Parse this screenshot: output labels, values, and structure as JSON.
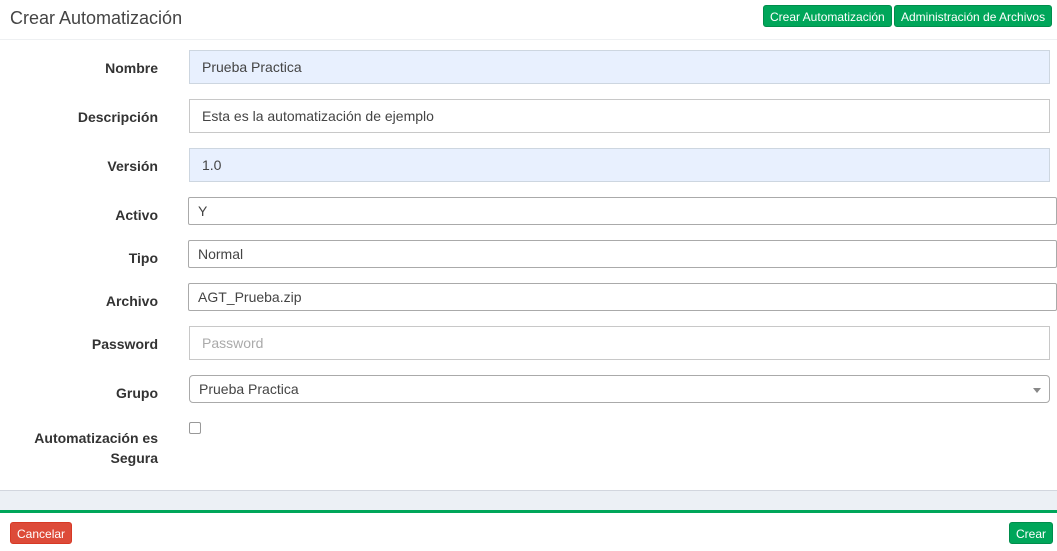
{
  "header": {
    "title": "Crear Automatización",
    "create_button": "Crear Automatización",
    "files_button": "Administración de Archivos"
  },
  "form": {
    "nombre": {
      "label": "Nombre",
      "value": "Prueba Practica"
    },
    "descripcion": {
      "label": "Descripción",
      "value": "Esta es la automatización de ejemplo"
    },
    "version": {
      "label": "Versión",
      "value": "1.0"
    },
    "activo": {
      "label": "Activo",
      "value": "Y"
    },
    "tipo": {
      "label": "Tipo",
      "value": "Normal"
    },
    "archivo": {
      "label": "Archivo",
      "value": "AGT_Prueba.zip"
    },
    "password": {
      "label": "Password",
      "placeholder": "Password"
    },
    "grupo": {
      "label": "Grupo",
      "value": "Prueba Practica"
    },
    "segura": {
      "label_line1": "Automatización es",
      "label_line2": "Segura",
      "checked": false
    }
  },
  "footer": {
    "cancel_label": "Cancelar",
    "submit_label": "Crear"
  },
  "colors": {
    "green": "#00a65a",
    "red": "#dd4b39",
    "readonly_bg": "#e8f0fe"
  }
}
